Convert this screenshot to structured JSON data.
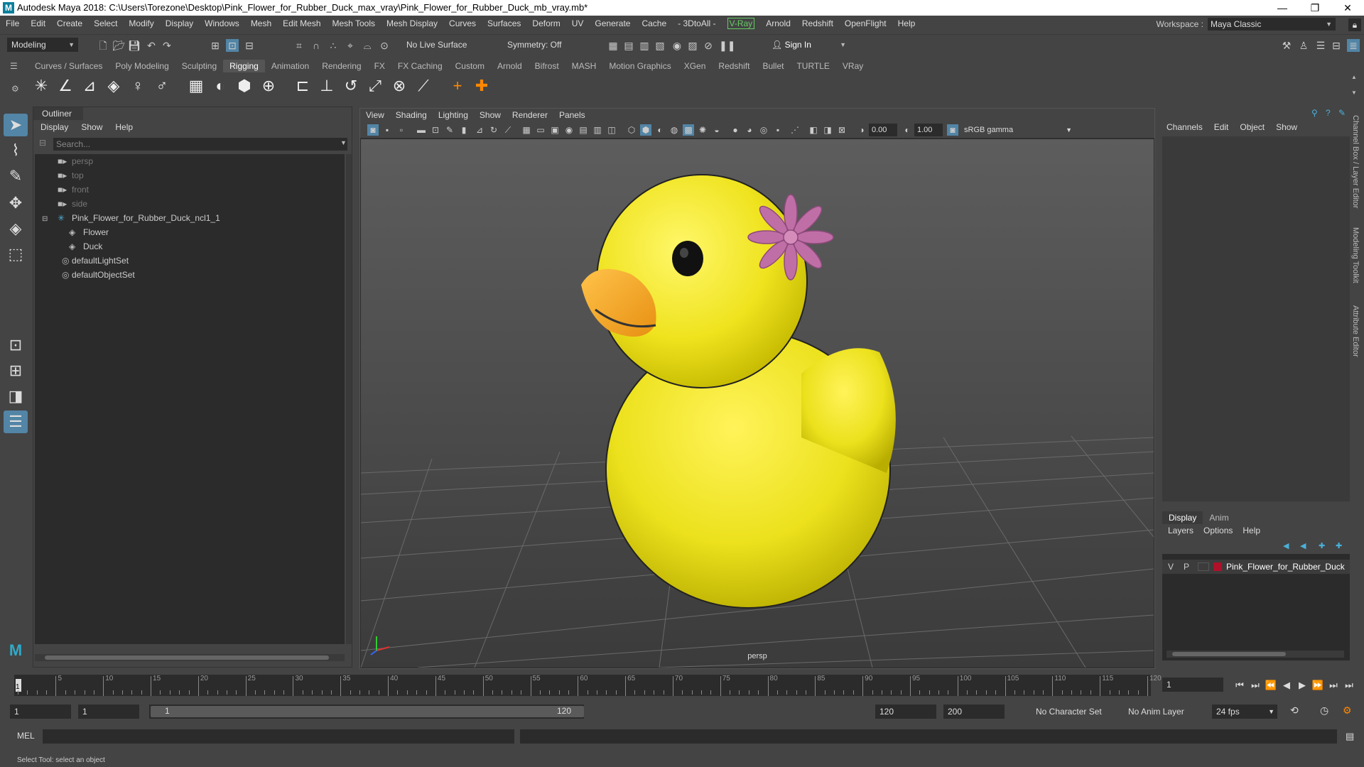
{
  "title": "Autodesk Maya 2018: C:\\Users\\Torezone\\Desktop\\Pink_Flower_for_Rubber_Duck_max_vray\\Pink_Flower_for_Rubber_Duck_mb_vray.mb*",
  "menu": [
    "File",
    "Edit",
    "Create",
    "Select",
    "Modify",
    "Display",
    "Windows",
    "Mesh",
    "Edit Mesh",
    "Mesh Tools",
    "Mesh Display",
    "Curves",
    "Surfaces",
    "Deform",
    "UV",
    "Generate",
    "Cache",
    "- 3DtoAll -",
    "V-Ray",
    "Arnold",
    "Redshift",
    "OpenFlight",
    "Help"
  ],
  "workspace": {
    "label": "Workspace :",
    "value": "Maya Classic"
  },
  "status": {
    "mode": "Modeling",
    "live_surface": "No Live Surface",
    "symmetry": "Symmetry: Off",
    "sign_in": "Sign In"
  },
  "shelf_tabs": [
    "Curves / Surfaces",
    "Poly Modeling",
    "Sculpting",
    "Rigging",
    "Animation",
    "Rendering",
    "FX",
    "FX Caching",
    "Custom",
    "Arnold",
    "Bifrost",
    "MASH",
    "Motion Graphics",
    "XGen",
    "Redshift",
    "Bullet",
    "TURTLE",
    "VRay"
  ],
  "active_shelf": "Rigging",
  "outliner": {
    "title": "Outliner",
    "menu": [
      "Display",
      "Show",
      "Help"
    ],
    "search_placeholder": "Search...",
    "items": [
      {
        "label": "persp",
        "dim": true
      },
      {
        "label": "top",
        "dim": true
      },
      {
        "label": "front",
        "dim": true
      },
      {
        "label": "side",
        "dim": true
      },
      {
        "label": "Pink_Flower_for_Rubber_Duck_ncl1_1",
        "dim": false
      },
      {
        "label": "Flower",
        "dim": false
      },
      {
        "label": "Duck",
        "dim": false
      },
      {
        "label": "defaultLightSet",
        "dim": false
      },
      {
        "label": "defaultObjectSet",
        "dim": false
      }
    ]
  },
  "viewport": {
    "menu": [
      "View",
      "Shading",
      "Lighting",
      "Show",
      "Renderer",
      "Panels"
    ],
    "field1": "0.00",
    "field2": "1.00",
    "colorspace": "sRGB gamma",
    "camera": "persp"
  },
  "channelbox": {
    "menu": [
      "Channels",
      "Edit",
      "Object",
      "Show"
    ],
    "layer_tabs": [
      "Display",
      "Anim"
    ],
    "layer_menu": [
      "Layers",
      "Options",
      "Help"
    ],
    "layer": {
      "v": "V",
      "p": "P",
      "name": "Pink_Flower_for_Rubber_Duck",
      "color": "#b0102a"
    }
  },
  "side_tabs": [
    "Channel Box / Layer Editor",
    "Modeling Toolkit",
    "Attribute Editor"
  ],
  "timeline": {
    "ticks": [
      "5",
      "10",
      "15",
      "20",
      "25",
      "30",
      "35",
      "40",
      "45",
      "50",
      "55",
      "60",
      "65",
      "70",
      "75",
      "80",
      "85",
      "90",
      "95",
      "100",
      "105",
      "110",
      "115",
      "120"
    ],
    "current_frame": "1"
  },
  "range": {
    "start": "1",
    "playback_start": "1",
    "slider_start": "1",
    "slider_end": "120",
    "playback_end": "120",
    "end": "200",
    "character_set": "No Character Set",
    "anim_layer": "No Anim Layer",
    "fps": "24 fps"
  },
  "cmd": {
    "label": "MEL"
  },
  "help_line": "Select Tool: select an object"
}
